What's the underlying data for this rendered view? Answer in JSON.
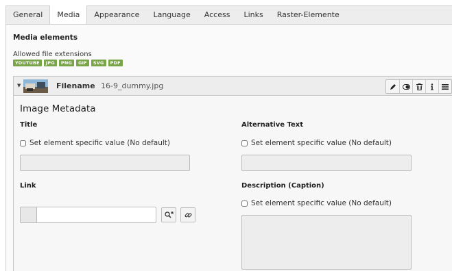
{
  "tabs": [
    {
      "label": "General"
    },
    {
      "label": "Media"
    },
    {
      "label": "Appearance"
    },
    {
      "label": "Language"
    },
    {
      "label": "Access"
    },
    {
      "label": "Links"
    },
    {
      "label": "Raster-Elemente"
    }
  ],
  "active_tab": "Media",
  "section": {
    "title": "Media elements",
    "allowed_label": "Allowed file extensions",
    "extensions": [
      "YOUTUBE",
      "JPG",
      "PNG",
      "GIF",
      "SVG",
      "PDF"
    ]
  },
  "record": {
    "field_label": "Filename",
    "field_value": "16-9_dummy.jpg",
    "controls": [
      "edit-icon",
      "toggle-visibility-icon",
      "delete-icon",
      "info-icon",
      "drag-handle-icon"
    ],
    "metadata_title": "Image Metadata",
    "title_label": "Title",
    "title_checkbox": "Set element specific value (No default)",
    "alt_label": "Alternative Text",
    "alt_checkbox": "Set element specific value (No default)",
    "link_label": "Link",
    "link_value": "",
    "caption_label": "Description (Caption)",
    "caption_checkbox": "Set element specific value (No default)"
  },
  "colors": {
    "badge": "#79a548",
    "tabbar": "#ededed",
    "panel": "#fafafa"
  }
}
